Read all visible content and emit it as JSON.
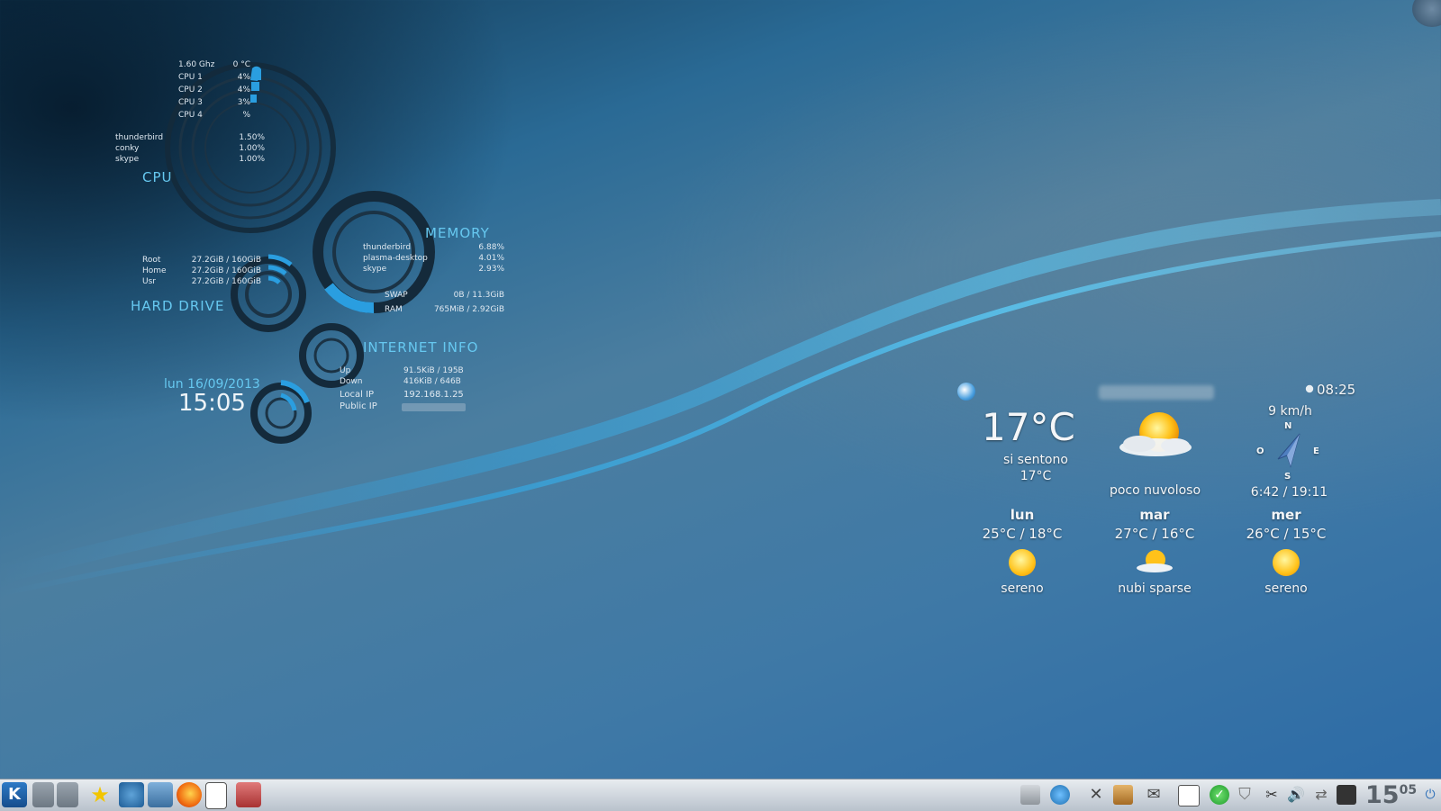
{
  "colors": {
    "accent": "#2a9ee0",
    "ring": "#1b3345",
    "label": "#66c8f0"
  },
  "cpu": {
    "freq": "1.60 Ghz",
    "temp": "0 °C",
    "cores": [
      {
        "label": "CPU 1",
        "value": "4%"
      },
      {
        "label": "CPU 2",
        "value": "4%"
      },
      {
        "label": "CPU 3",
        "value": "3%"
      },
      {
        "label": "CPU 4",
        "value": "%"
      }
    ],
    "processes": [
      {
        "name": "thunderbird",
        "value": "1.50%"
      },
      {
        "name": "conky",
        "value": "1.00%"
      },
      {
        "name": "skype",
        "value": "1.00%"
      }
    ],
    "title": "CPU"
  },
  "memory": {
    "title": "MEMORY",
    "processes": [
      {
        "name": "thunderbird",
        "value": "6.88%"
      },
      {
        "name": "plasma-desktop",
        "value": "4.01%"
      },
      {
        "name": "skype",
        "value": "2.93%"
      }
    ],
    "swap_label": "SWAP",
    "swap_value": "0B  / 11.3GiB",
    "ram_label": "RAM",
    "ram_value": "765MiB / 2.92GiB"
  },
  "harddrive": {
    "title": "HARD DRIVE",
    "rows": [
      {
        "name": "Root",
        "value": "27.2GiB / 160GiB"
      },
      {
        "name": "Home",
        "value": "27.2GiB / 160GiB"
      },
      {
        "name": "Usr",
        "value": "27.2GiB / 160GiB"
      }
    ]
  },
  "internet": {
    "title": "INTERNET INFO",
    "up_label": "Up",
    "up_value": "91.5KiB / 195B",
    "down_label": "Down",
    "down_value": "416KiB / 646B",
    "local_label": "Local IP",
    "local_value": "192.168.1.25",
    "public_label": "Public IP"
  },
  "clock": {
    "date": "lun 16/09/2013",
    "time": "15:05"
  },
  "weather": {
    "update_time": "08:25",
    "temp": "17°C",
    "feels_label": "si sentono",
    "feels_value": "17°C",
    "condition": "poco nuvoloso",
    "wind": "9 km/h",
    "compass": {
      "n": "N",
      "s": "S",
      "e": "E",
      "w": "O"
    },
    "sun": "6:42 / 19:11",
    "forecast": [
      {
        "day": "lun",
        "range": "25°C / 18°C",
        "desc": "sereno",
        "icon": "sun-icon"
      },
      {
        "day": "mar",
        "range": "27°C / 16°C",
        "desc": "nubi sparse",
        "icon": "partly-cloudy-icon"
      },
      {
        "day": "mer",
        "range": "26°C / 15°C",
        "desc": "sereno",
        "icon": "sun-icon"
      }
    ]
  },
  "taskbar": {
    "clock_hour": "15",
    "clock_min": "05"
  }
}
